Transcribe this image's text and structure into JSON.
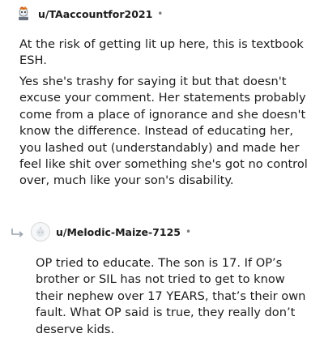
{
  "comment": {
    "username": "u/TAaccountfor2021",
    "separator": "•",
    "avatar_icon": "snoo-avatar-icon",
    "paragraphs": [
      "At the risk of getting lit up here, this is textbook ESH.",
      "Yes she's trashy for saying it but that doesn't excuse your comment. Her statements probably come from a place of ignorance and she doesn't know the difference. Instead of educating her, you lashed out (understandably) and made her feel like shit over something she's got no control over, much like your son's disability."
    ]
  },
  "reply": {
    "reply_icon": "reply-arrow-icon",
    "avatar_icon": "default-avatar-icon",
    "username": "u/Melodic-Maize-7125",
    "separator": "•",
    "text": "OP tried to educate. The son is 17. If OP’s brother or SIL has not tried to get to know their nephew over 17 YEARS, that’s their own fault. What OP said is true, they really don’t deserve kids."
  }
}
